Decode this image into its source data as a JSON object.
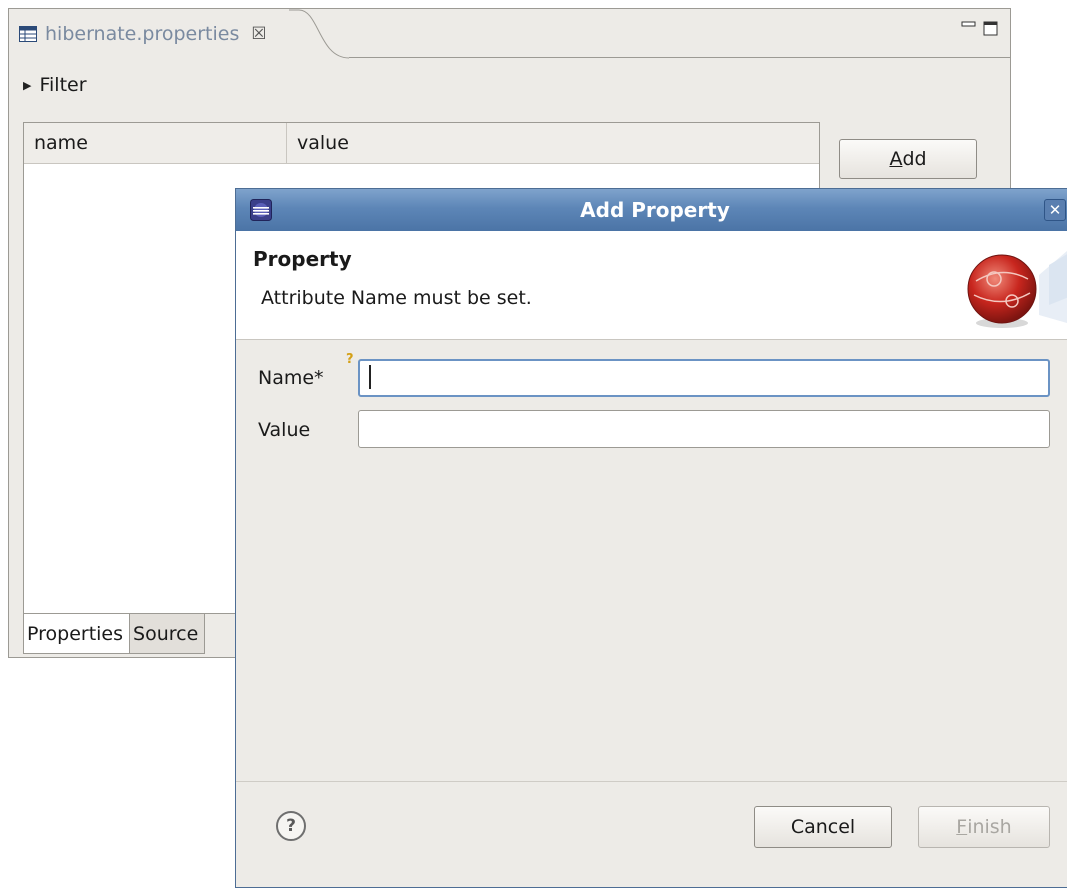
{
  "editor": {
    "tab_title": "hibernate.properties",
    "tab_close": "☒",
    "filter_label": "Filter",
    "columns": [
      "name",
      "value"
    ],
    "add_button": {
      "mnemonic": "A",
      "rest": "dd"
    },
    "bottom_tabs": [
      "Properties",
      "Source"
    ]
  },
  "dialog": {
    "title": "Add Property",
    "close_glyph": "✕",
    "banner_title": "Property",
    "banner_message": "Attribute Name must be set.",
    "required_marker": "?",
    "fields": [
      {
        "label": "Name*",
        "value": ""
      },
      {
        "label": "Value",
        "value": ""
      }
    ],
    "help_glyph": "?",
    "cancel_label": "Cancel",
    "finish_button": {
      "mnemonic": "F",
      "rest": "inish"
    }
  },
  "colors": {
    "titlebar": "#5d86b7",
    "panel_bg": "#edebe7",
    "focus_border": "#6b93c4"
  },
  "icons": [
    "file-table-icon",
    "close-tab-icon",
    "minimize-icon",
    "maximize-icon",
    "expand-triangle-icon",
    "eclipse-icon",
    "window-close-icon",
    "wizard-graphic-icon",
    "help-icon"
  ]
}
